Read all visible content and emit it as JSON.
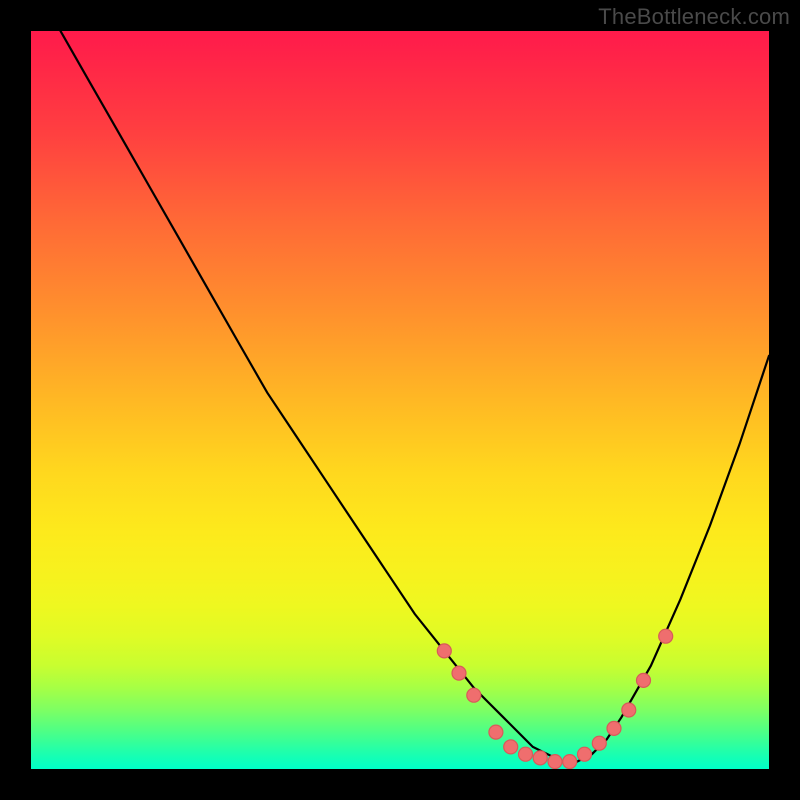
{
  "attribution": "TheBottleneck.com",
  "colors": {
    "dot_fill": "#ef6e6e",
    "dot_stroke": "#d85a5a",
    "curve_stroke": "#000000"
  },
  "chart_data": {
    "type": "line",
    "title": "",
    "xlabel": "",
    "ylabel": "",
    "xlim": [
      0,
      100
    ],
    "ylim": [
      0,
      100
    ],
    "series": [
      {
        "name": "bottleneck_curve",
        "x": [
          0,
          4,
          8,
          12,
          16,
          20,
          24,
          28,
          32,
          36,
          40,
          44,
          48,
          52,
          56,
          60,
          62,
          64,
          66,
          68,
          70,
          72,
          74,
          76,
          78,
          80,
          84,
          88,
          92,
          96,
          100
        ],
        "values": [
          108,
          100,
          93,
          86,
          79,
          72,
          65,
          58,
          51,
          45,
          39,
          33,
          27,
          21,
          16,
          11,
          9,
          7,
          5,
          3,
          2,
          1,
          1,
          2,
          4,
          7,
          14,
          23,
          33,
          44,
          56
        ]
      }
    ],
    "highlight_points": [
      {
        "x": 56,
        "y": 16
      },
      {
        "x": 58,
        "y": 13
      },
      {
        "x": 60,
        "y": 10
      },
      {
        "x": 63,
        "y": 5
      },
      {
        "x": 65,
        "y": 3
      },
      {
        "x": 67,
        "y": 2
      },
      {
        "x": 69,
        "y": 1.5
      },
      {
        "x": 71,
        "y": 1
      },
      {
        "x": 73,
        "y": 1
      },
      {
        "x": 75,
        "y": 2
      },
      {
        "x": 77,
        "y": 3.5
      },
      {
        "x": 79,
        "y": 5.5
      },
      {
        "x": 81,
        "y": 8
      },
      {
        "x": 83,
        "y": 12
      },
      {
        "x": 86,
        "y": 18
      }
    ]
  }
}
